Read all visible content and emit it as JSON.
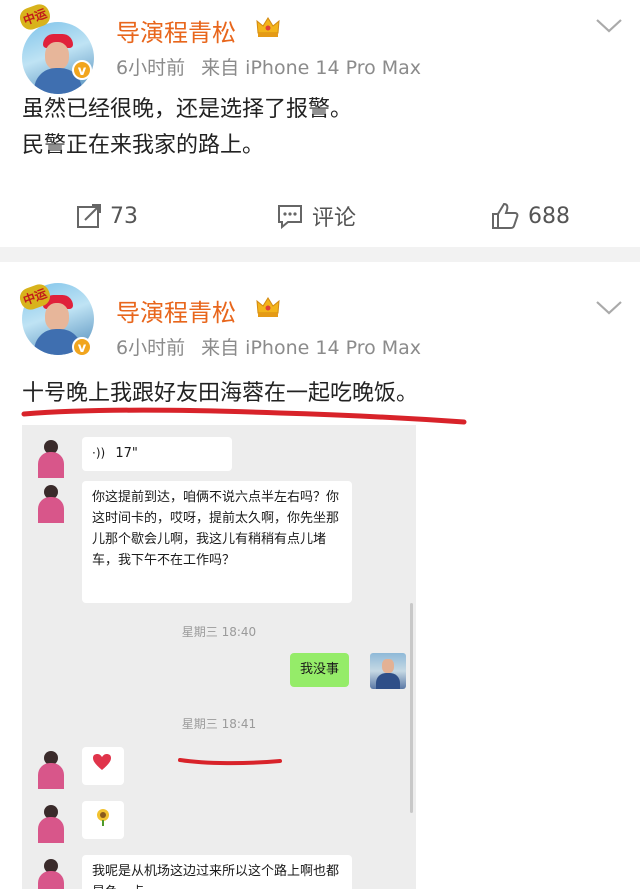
{
  "posts": [
    {
      "username": "导演程青松",
      "badge_text": "中运",
      "time": "6小时前",
      "source": "来自 iPhone 14 Pro Max",
      "text_lines": [
        "虽然已经很晚，还是选择了报警。",
        "民警正在来我家的路上。"
      ],
      "actions": {
        "repost_count": "73",
        "comment_label": "评论",
        "like_count": "688"
      }
    },
    {
      "username": "导演程青松",
      "badge_text": "中运",
      "time": "6小时前",
      "source": "来自 iPhone 14 Pro Max",
      "text": "十号晚上我跟好友田海蓉在一起吃晚饭。",
      "chat": {
        "voice_duration": "17\"",
        "message_1": "你这提前到达，咱俩不说六点半左右吗？你这时间卡的，哎呀，提前太久啊，你先坐那儿那个歇会儿啊，我这儿有稍稍有点儿堵车，我下午不在工作吗？",
        "timestamp_1": "星期三 18:40",
        "my_reply": "我没事",
        "timestamp_2": "星期三 18:41",
        "last_message": "我呢是从机场这边过来所以这个路上啊也都是争一点"
      }
    }
  ],
  "icons": {
    "verified": "verified-badge-icon",
    "crown": "crown-icon",
    "chevron": "chevron-down-icon",
    "repost": "repost-icon",
    "comment": "comment-icon",
    "like": "thumbs-up-icon"
  },
  "colors": {
    "username": "#e8661c",
    "annotation_red": "#d8232a",
    "chat_green": "#95ec69"
  }
}
